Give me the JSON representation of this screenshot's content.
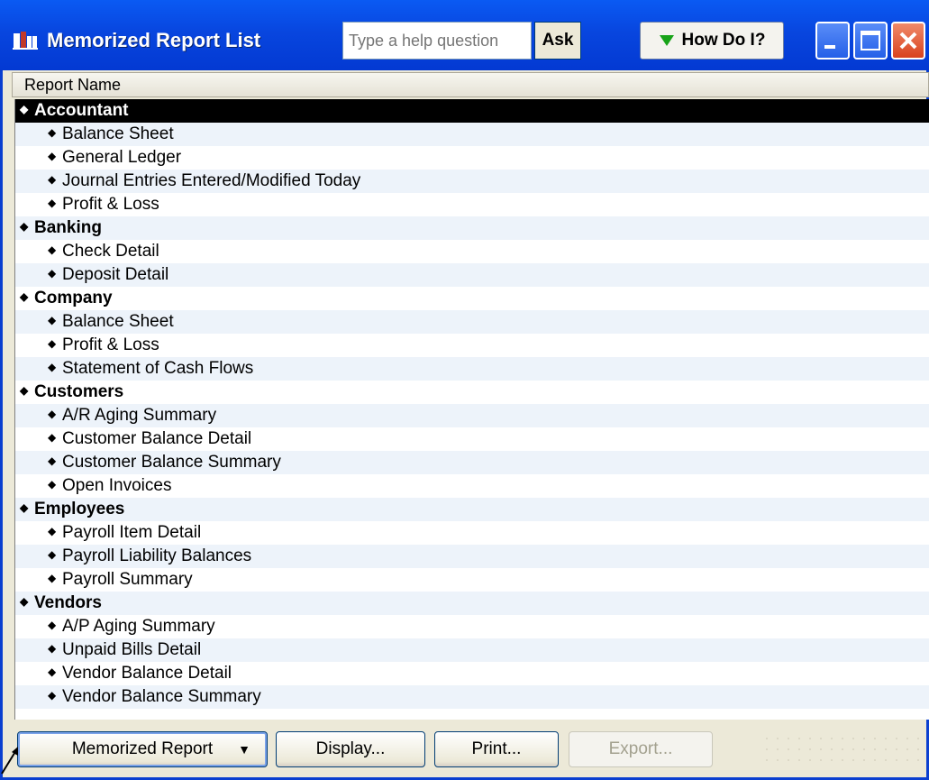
{
  "window": {
    "title": "Memorized Report List",
    "help_placeholder": "Type a help question",
    "ask_label": "Ask",
    "howdoi_label": "How Do I?"
  },
  "list": {
    "column_header": "Report Name",
    "rows": [
      {
        "label": "Accountant",
        "kind": "group"
      },
      {
        "label": "Balance Sheet",
        "kind": "item"
      },
      {
        "label": "General Ledger",
        "kind": "item"
      },
      {
        "label": "Journal Entries Entered/Modified Today",
        "kind": "item"
      },
      {
        "label": "Profit & Loss",
        "kind": "item"
      },
      {
        "label": "Banking",
        "kind": "group"
      },
      {
        "label": "Check Detail",
        "kind": "item"
      },
      {
        "label": "Deposit Detail",
        "kind": "item"
      },
      {
        "label": "Company",
        "kind": "group"
      },
      {
        "label": "Balance Sheet",
        "kind": "item"
      },
      {
        "label": "Profit & Loss",
        "kind": "item"
      },
      {
        "label": "Statement of Cash Flows",
        "kind": "item"
      },
      {
        "label": "Customers",
        "kind": "group"
      },
      {
        "label": "A/R Aging Summary",
        "kind": "item"
      },
      {
        "label": "Customer Balance Detail",
        "kind": "item"
      },
      {
        "label": "Customer Balance Summary",
        "kind": "item"
      },
      {
        "label": "Open Invoices",
        "kind": "item"
      },
      {
        "label": "Employees",
        "kind": "group"
      },
      {
        "label": "Payroll Item Detail",
        "kind": "item"
      },
      {
        "label": "Payroll Liability Balances",
        "kind": "item"
      },
      {
        "label": "Payroll Summary",
        "kind": "item"
      },
      {
        "label": "Vendors",
        "kind": "group"
      },
      {
        "label": "A/P Aging Summary",
        "kind": "item"
      },
      {
        "label": "Unpaid Bills Detail",
        "kind": "item"
      },
      {
        "label": "Vendor Balance Detail",
        "kind": "item"
      },
      {
        "label": "Vendor Balance Summary",
        "kind": "item"
      }
    ],
    "selected_label": "Accountant"
  },
  "footer": {
    "memorized_report_label": "Memorized Report",
    "display_label": "Display...",
    "print_label": "Print...",
    "export_label": "Export..."
  },
  "colors": {
    "titlebar": "#0846df",
    "selection": "#000000",
    "row_alt": "#edf3fa"
  }
}
